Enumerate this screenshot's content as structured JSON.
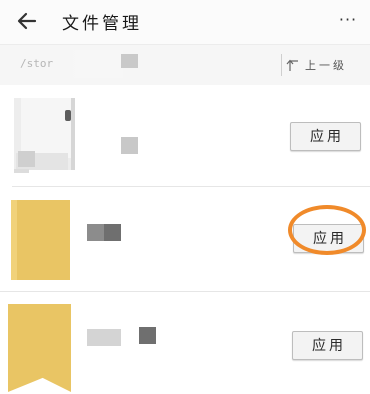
{
  "header": {
    "title": "文件管理",
    "back_icon": "arrow-left-icon",
    "more_icon": "more-horizontal-icon",
    "more_glyph": "···"
  },
  "path_bar": {
    "path": "/stor",
    "up_label": "上一级",
    "up_icon": "level-up-icon"
  },
  "files": [
    {
      "type": "image",
      "apply_label": "应用"
    },
    {
      "type": "folder",
      "apply_label": "应用",
      "highlighted": true
    },
    {
      "type": "folder",
      "apply_label": "应用"
    }
  ],
  "colors": {
    "folder": "#e9c564",
    "highlight": "#f08a2a",
    "button_bg": "#f3f3f3"
  }
}
